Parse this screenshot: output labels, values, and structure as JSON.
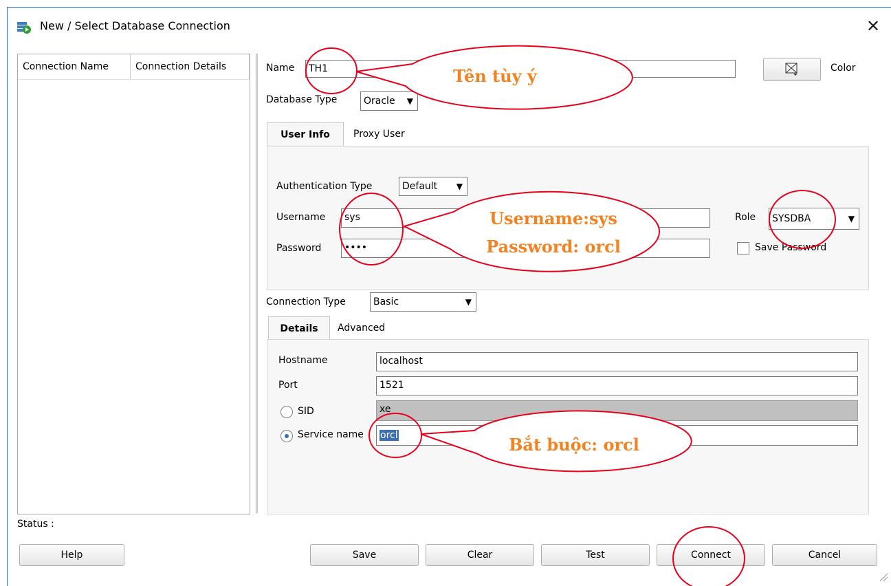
{
  "window": {
    "title": "New / Select Database Connection",
    "close_glyph": "✕"
  },
  "list": {
    "columns": [
      "Connection Name",
      "Connection Details"
    ]
  },
  "name": {
    "label": "Name",
    "value": "TH1"
  },
  "color": {
    "label": "Color",
    "icon": "color-picker-icon"
  },
  "database_type": {
    "label": "Database Type",
    "value": "Oracle"
  },
  "tabs_top": [
    "User Info",
    "Proxy User"
  ],
  "auth": {
    "label": "Authentication Type",
    "value": "Default"
  },
  "username": {
    "label": "Username",
    "value": "sys"
  },
  "password": {
    "label": "Password",
    "value": "••••"
  },
  "role": {
    "label": "Role",
    "value": "SYSDBA"
  },
  "save_password": {
    "label": "Save Password",
    "checked": false
  },
  "connection_type": {
    "label": "Connection Type",
    "value": "Basic"
  },
  "tabs_bottom": [
    "Details",
    "Advanced"
  ],
  "hostname": {
    "label": "Hostname",
    "value": "localhost"
  },
  "port": {
    "label": "Port",
    "value": "1521"
  },
  "sid": {
    "label": "SID",
    "value": "xe",
    "selected": false
  },
  "service": {
    "label": "Service name",
    "value": "orcl",
    "selected": true
  },
  "status": {
    "label": "Status :"
  },
  "buttons": {
    "help": "Help",
    "save": "Save",
    "clear": "Clear",
    "test": "Test",
    "connect": "Connect",
    "cancel": "Cancel"
  },
  "annotations": {
    "name_note": "Tên tùy ý",
    "cred_line1": "Username:sys",
    "cred_line2": "Password: orcl",
    "service_note": "Bắt buộc: orcl",
    "color": "#e8001c",
    "text_color": "#f58220"
  }
}
